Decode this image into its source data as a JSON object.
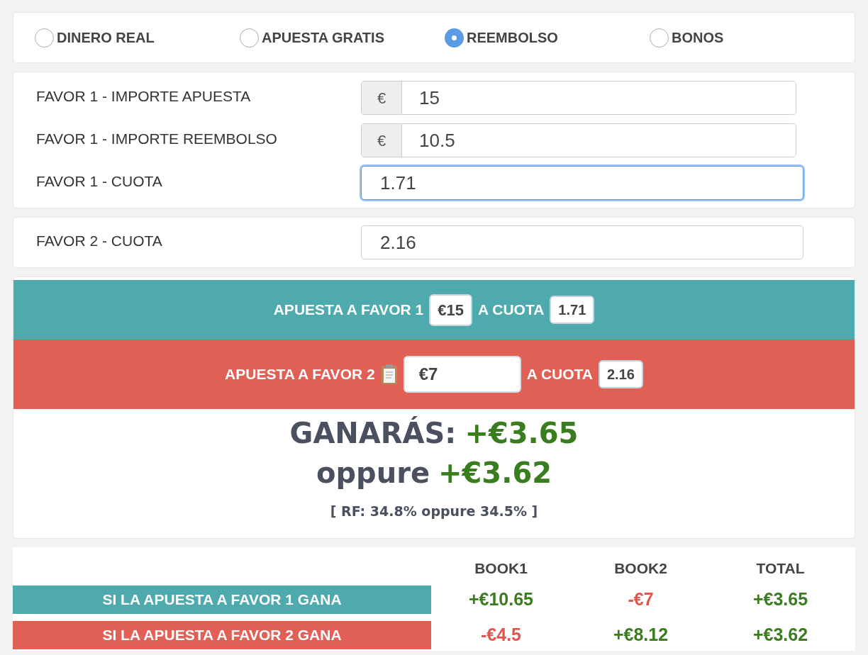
{
  "modes": [
    {
      "label": "DINERO REAL",
      "selected": false
    },
    {
      "label": "APUESTA GRATIS",
      "selected": false
    },
    {
      "label": "REEMBOLSO",
      "selected": true
    },
    {
      "label": "BONOS",
      "selected": false
    }
  ],
  "favor1_fields": [
    {
      "label": "FAVOR 1 - IMPORTE APUESTA",
      "prefix": "€",
      "value": "15",
      "focused": false
    },
    {
      "label": "FAVOR 1 - IMPORTE REEMBOLSO",
      "prefix": "€",
      "value": "10.5",
      "focused": false
    },
    {
      "label": "FAVOR 1 - CUOTA",
      "value": "1.71",
      "focused": true
    }
  ],
  "favor2_fields": [
    {
      "label": "FAVOR 2 - CUOTA",
      "value": "2.16",
      "focused": false
    }
  ],
  "bets": [
    {
      "kind": "favor1",
      "label": "APUESTA A FAVOR 1",
      "stake": "€15",
      "odds_label": "A CUOTA",
      "odds": "1.71"
    },
    {
      "kind": "favor2",
      "label": "APUESTA A FAVOR 2",
      "stake": "€7",
      "odds_label": "A CUOTA",
      "odds": "2.16"
    }
  ],
  "result": {
    "label": "GANARÁS:",
    "value": "+€3.65",
    "alt_label": "oppure",
    "alt_value": "+€3.62",
    "rf": "[ RF: 34.8% oppure 34.5% ]"
  },
  "table": {
    "columns": [
      "BOOK1",
      "BOOK2",
      "TOTAL"
    ],
    "rows": [
      {
        "label": "SI LA APUESTA A FAVOR 1 GANA",
        "color": "#4eaaad",
        "cells": [
          {
            "text": "+€10.65",
            "positive": true
          },
          {
            "text": "-€7",
            "positive": false
          },
          {
            "text": "+€3.65",
            "positive": true
          }
        ]
      },
      {
        "label": "SI LA APUESTA A FAVOR 2 GANA",
        "color": "#e06055",
        "cells": [
          {
            "text": "-€4.5",
            "positive": false
          },
          {
            "text": "+€8.12",
            "positive": true
          },
          {
            "text": "+€3.62",
            "positive": true
          }
        ]
      }
    ]
  }
}
